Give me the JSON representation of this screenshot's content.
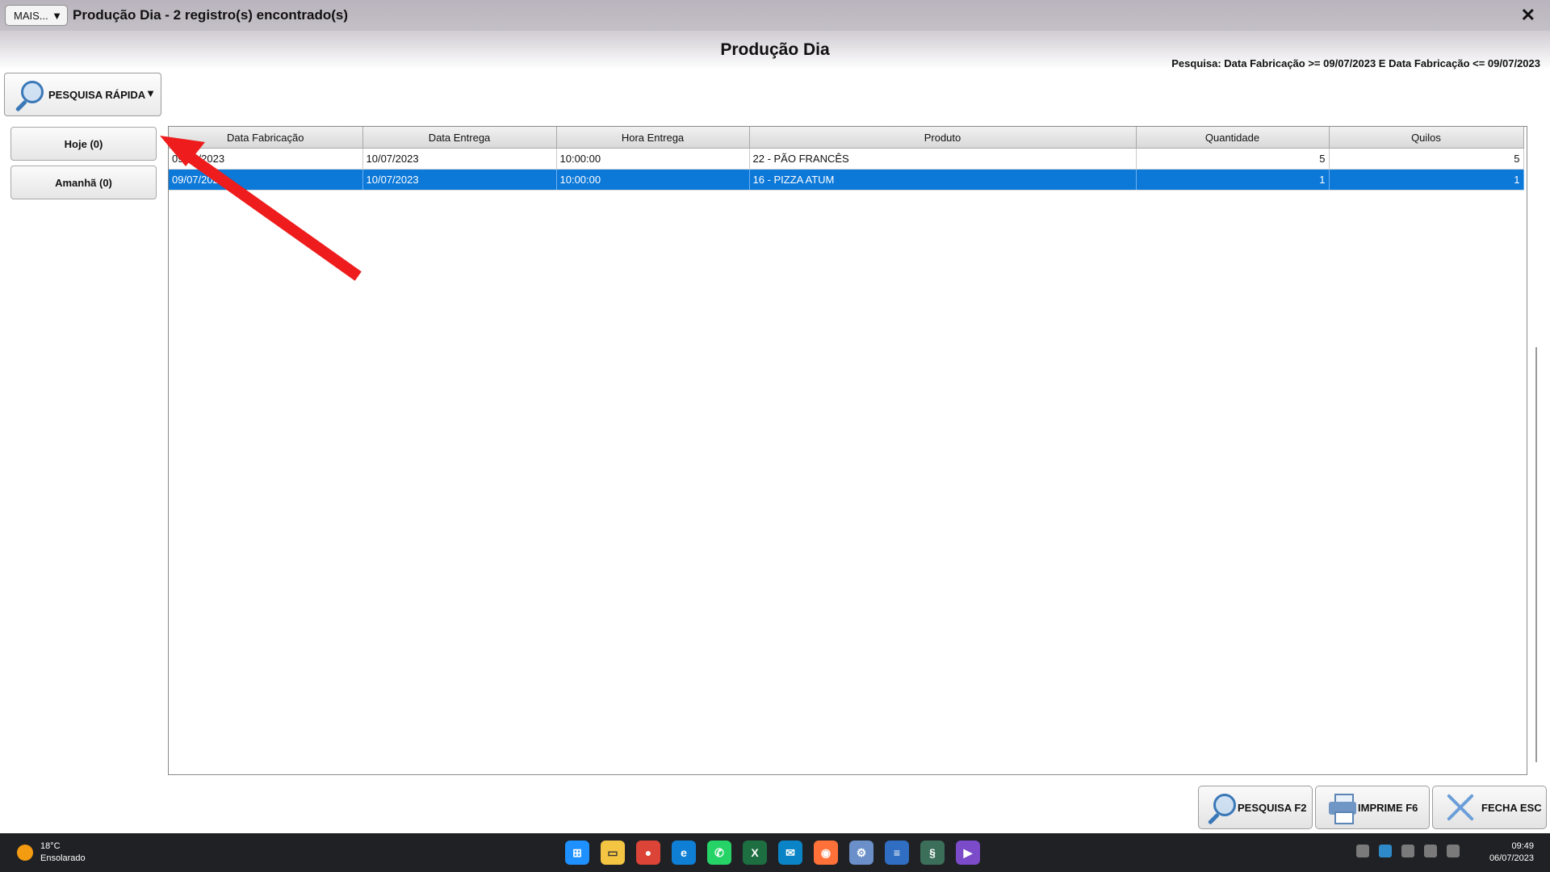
{
  "window": {
    "mais_label": "MAIS...",
    "title": "Produção Dia - 2 registro(s) encontrado(s)",
    "close": "✕"
  },
  "page": {
    "title": "Produção Dia",
    "search_filter": "Pesquisa: Data Fabricação >= 09/07/2023 E Data Fabricação <= 09/07/2023"
  },
  "quick_search": {
    "label": "PESQUISA RÁPIDA"
  },
  "sidebar": {
    "items": [
      {
        "label": "Hoje (0)"
      },
      {
        "label": "Amanhã (0)"
      }
    ]
  },
  "grid": {
    "columns": [
      "Data Fabricação",
      "Data Entrega",
      "Hora Entrega",
      "Produto",
      "Quantidade",
      "Quilos"
    ],
    "rows": [
      [
        "09/07/2023",
        "10/07/2023",
        "10:00:00",
        "22 - PÃO FRANCÊS",
        "5",
        "5"
      ],
      [
        "09/07/2023",
        "10/07/2023",
        "10:00:00",
        "16 - PIZZA ATUM",
        "1",
        "1"
      ]
    ],
    "selected_row": 1
  },
  "buttons": {
    "pesquisa": "PESQUISA F2",
    "imprime": "IMPRIME F6",
    "fecha": "FECHA ESC"
  },
  "taskbar": {
    "temp": "18°C",
    "weather": "Ensolarado",
    "time": "09:49",
    "date": "06/07/2023",
    "icons": [
      "windows-start",
      "file-explorer",
      "chrome",
      "edge",
      "whatsapp",
      "excel",
      "mail",
      "firefox",
      "settings",
      "notepad",
      "app",
      "media"
    ]
  },
  "colors": {
    "selected_row": "#0c78d8",
    "annotation_arrow": "#ee1c1c"
  }
}
